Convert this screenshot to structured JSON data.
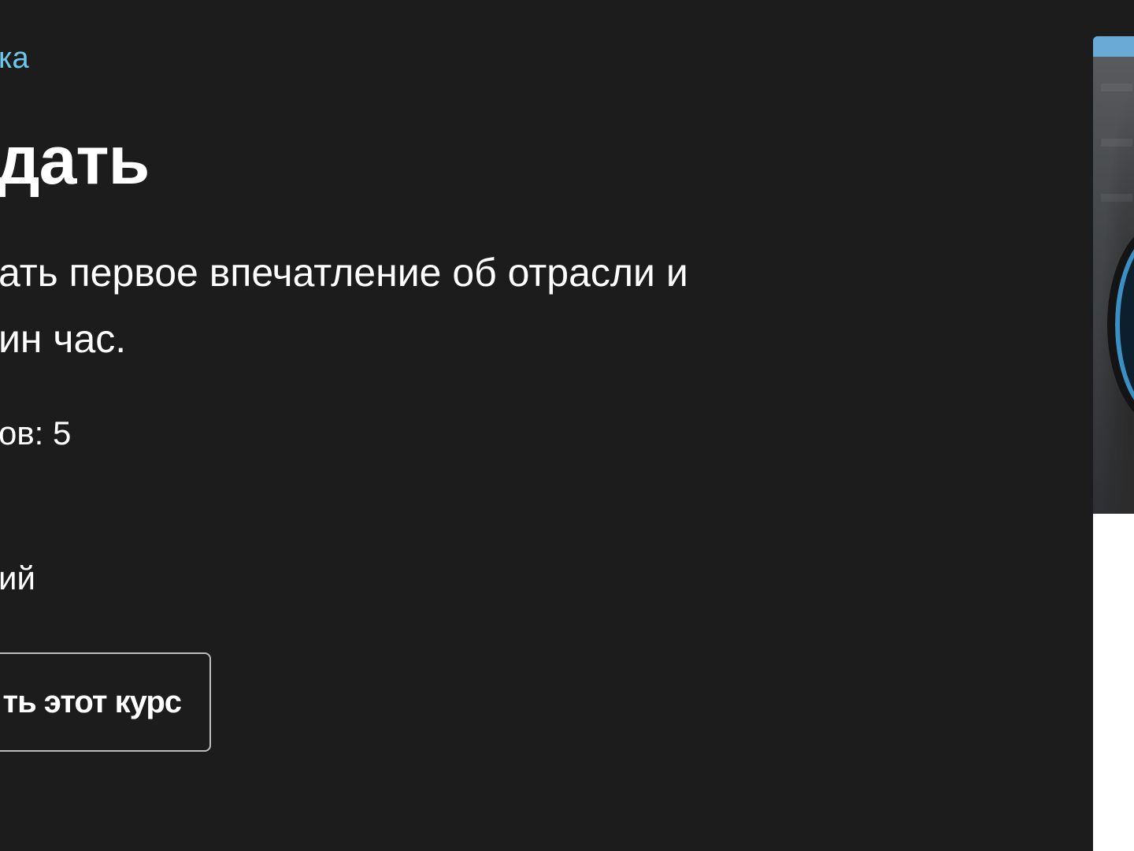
{
  "hero": {
    "breadcrumb": "ка",
    "title": "дать",
    "description_line1": "ать первое впечатление об отрасли и",
    "description_line2": "ин час.",
    "lessons_text": "ов: 5",
    "level_text": "ий",
    "cta_label": "ть этот курс"
  },
  "card": {
    "image_label": "course-cover-image"
  },
  "colors": {
    "background": "#1c1c1c",
    "accent": "#6cc7ea",
    "card": "#ffffff"
  }
}
